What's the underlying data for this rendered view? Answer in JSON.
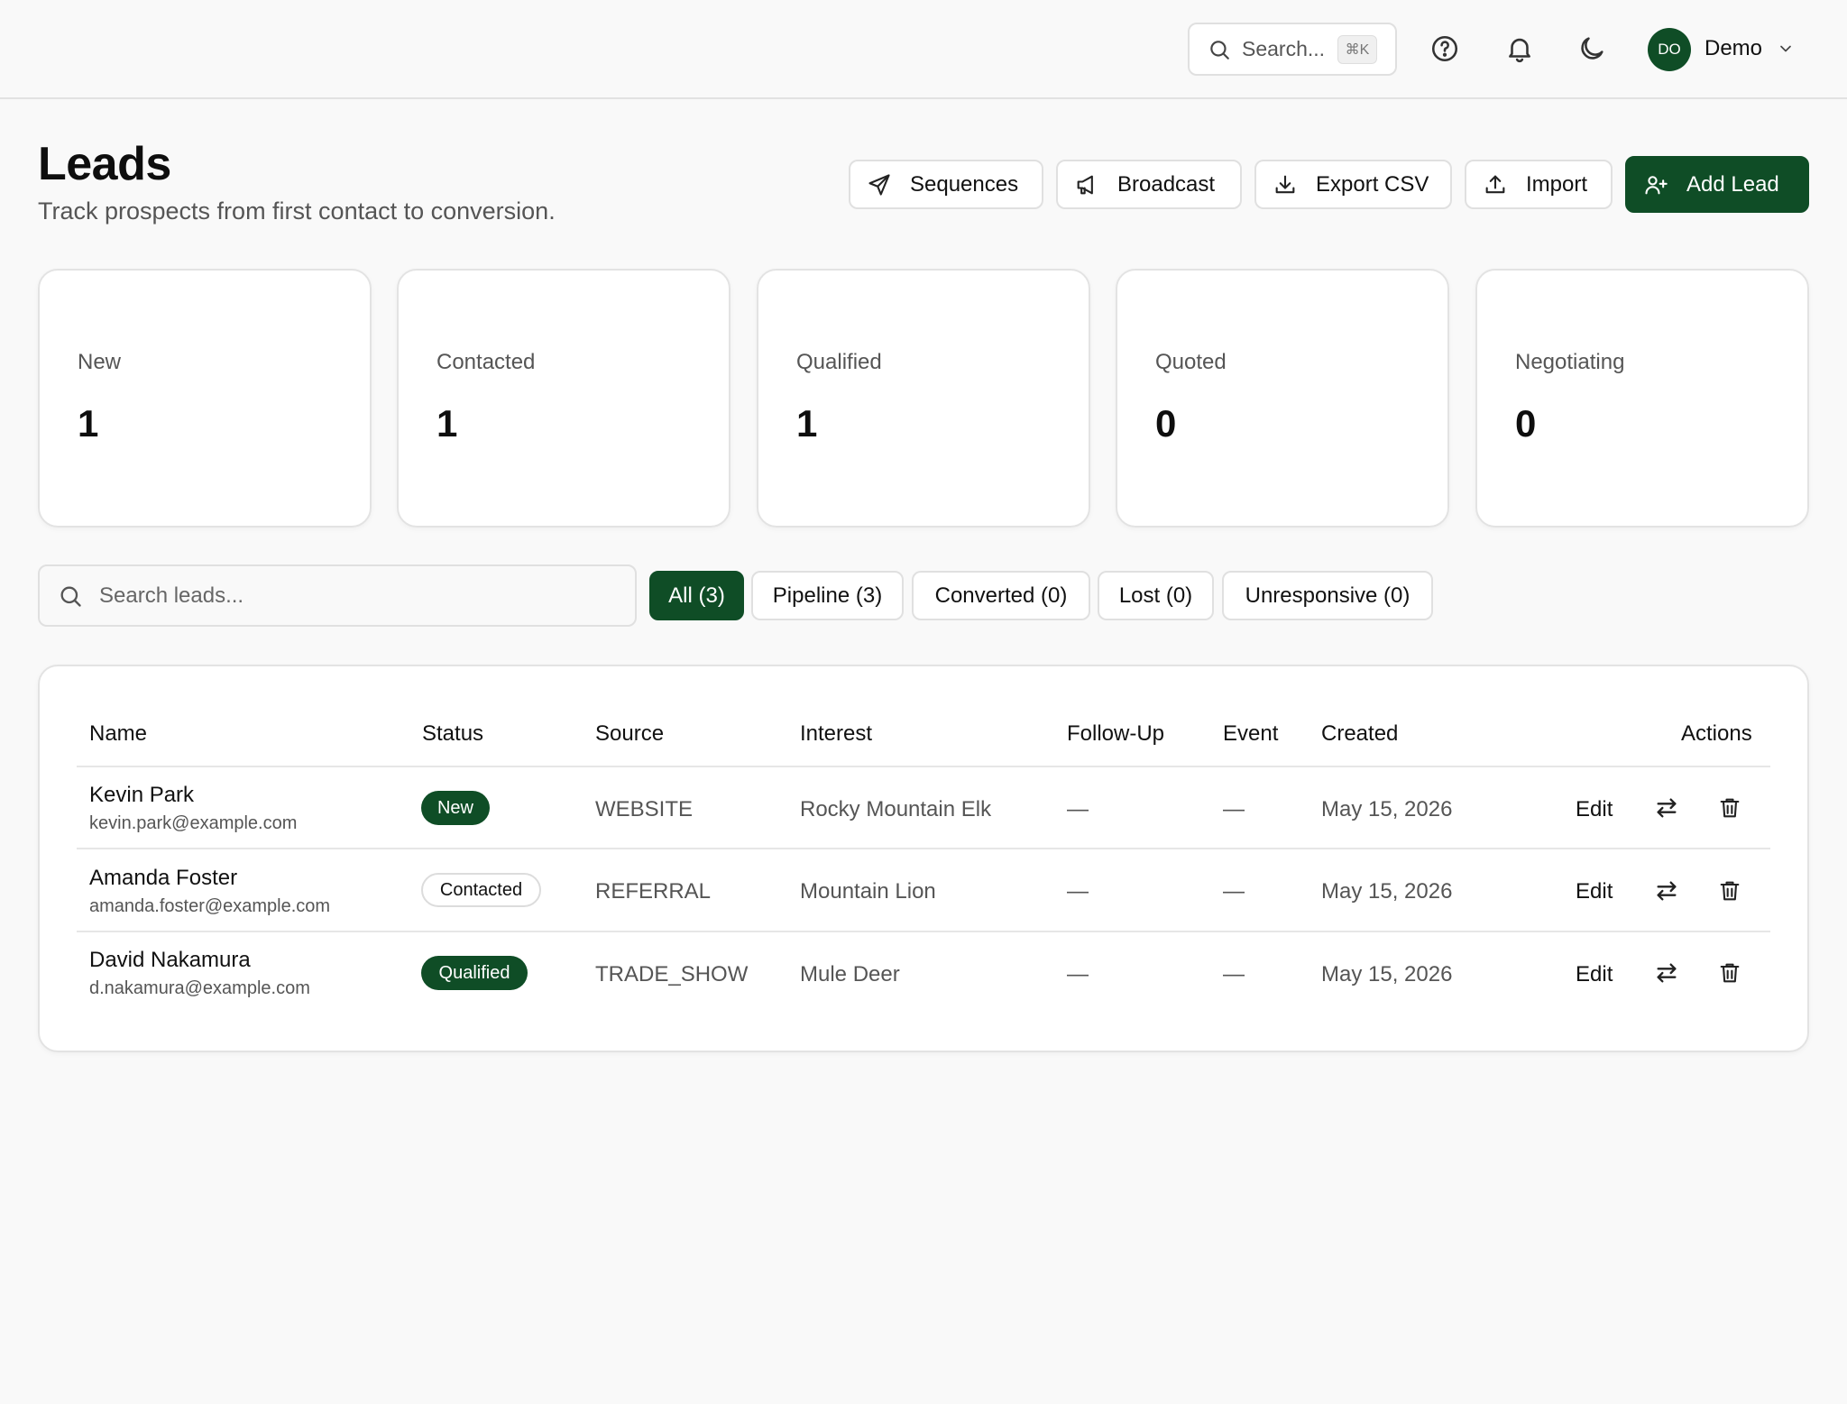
{
  "topbar": {
    "search_placeholder": "Search...",
    "search_shortcut": "⌘K",
    "user_initials": "DO",
    "user_name": "Demo"
  },
  "header": {
    "title": "Leads",
    "subtitle": "Track prospects from first contact to conversion.",
    "buttons": {
      "sequences": "Sequences",
      "broadcast": "Broadcast",
      "export_csv": "Export CSV",
      "import": "Import",
      "add_lead": "Add Lead"
    }
  },
  "stats": [
    {
      "label": "New",
      "value": "1"
    },
    {
      "label": "Contacted",
      "value": "1"
    },
    {
      "label": "Qualified",
      "value": "1"
    },
    {
      "label": "Quoted",
      "value": "0"
    },
    {
      "label": "Negotiating",
      "value": "0"
    }
  ],
  "filters": {
    "search_placeholder": "Search leads...",
    "tabs": [
      "All (3)",
      "Pipeline (3)",
      "Converted (0)",
      "Lost (0)",
      "Unresponsive (0)"
    ],
    "active_tab": "All (3)"
  },
  "table": {
    "columns": [
      "Name",
      "Status",
      "Source",
      "Interest",
      "Follow-Up",
      "Event",
      "Created",
      "Actions"
    ],
    "rows": [
      {
        "name": "Kevin Park",
        "email": "kevin.park@example.com",
        "status": "New",
        "source": "WEBSITE",
        "interest": "Rocky Mountain Elk",
        "follow_up": "—",
        "event": "—",
        "created": "May 15, 2026",
        "edit": "Edit"
      },
      {
        "name": "Amanda Foster",
        "email": "amanda.foster@example.com",
        "status": "Contacted",
        "source": "REFERRAL",
        "interest": "Mountain Lion",
        "follow_up": "—",
        "event": "—",
        "created": "May 15, 2026",
        "edit": "Edit"
      },
      {
        "name": "David Nakamura",
        "email": "d.nakamura@example.com",
        "status": "Qualified",
        "source": "TRADE_SHOW",
        "interest": "Mule Deer",
        "follow_up": "—",
        "event": "—",
        "created": "May 15, 2026",
        "edit": "Edit"
      }
    ]
  },
  "colors": {
    "brand": "#0f4d26",
    "background": "#f9f9f9",
    "card": "#ffffff",
    "border": "#e3e3e3"
  },
  "icons": [
    "search-icon",
    "help-icon",
    "bell-icon",
    "moon-icon",
    "chevron-down-icon",
    "send-icon",
    "megaphone-icon",
    "download-icon",
    "upload-icon",
    "user-plus-icon",
    "swap-icon",
    "trash-icon"
  ]
}
